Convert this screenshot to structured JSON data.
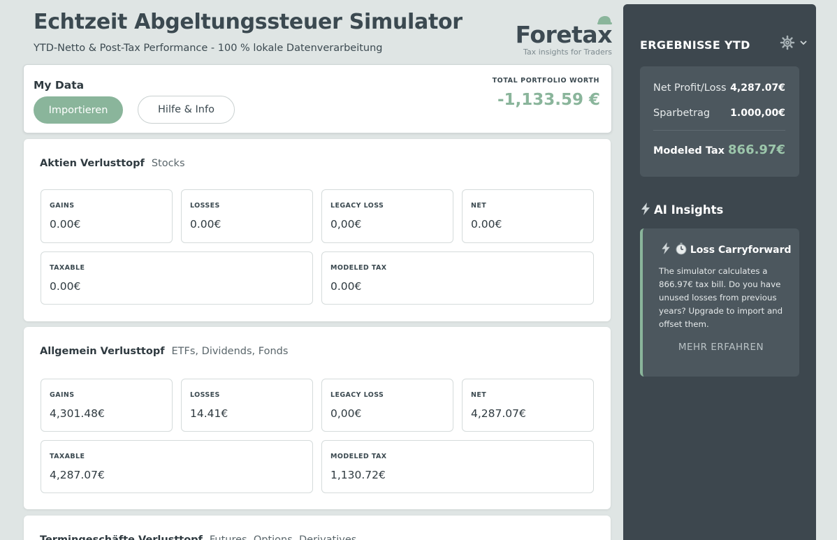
{
  "header": {
    "title": "Echtzeit Abgeltungssteuer Simulator",
    "subtitle": "YTD-Netto & Post-Tax Performance - 100 % lokale Datenverarbeitung",
    "brand_name": "Foretax",
    "brand_tagline": "Tax insights for Traders"
  },
  "my_data": {
    "title": "My Data",
    "import_label": "Importieren",
    "help_label": "Hilfe & Info",
    "worth_label": "TOTAL PORTFOLIO WORTH",
    "worth_value": "-1,133.59 €"
  },
  "pots": [
    {
      "title": "Aktien Verlusttopf",
      "subtitle": "Stocks",
      "gains_label": "GAINS",
      "gains": "0.00€",
      "losses_label": "LOSSES",
      "losses": "0.00€",
      "legacy_label": "LEGACY LOSS",
      "legacy": "0,00€",
      "net_label": "NET",
      "net": "0.00€",
      "taxable_label": "TAXABLE",
      "taxable": "0.00€",
      "tax_label": "MODELED TAX",
      "tax": "0.00€"
    },
    {
      "title": "Allgemein Verlusttopf",
      "subtitle": "ETFs, Dividends, Fonds",
      "gains_label": "GAINS",
      "gains": "4,301.48€",
      "losses_label": "LOSSES",
      "losses": "14.41€",
      "legacy_label": "LEGACY LOSS",
      "legacy": "0,00€",
      "net_label": "NET",
      "net": "4,287.07€",
      "taxable_label": "TAXABLE",
      "taxable": "4,287.07€",
      "tax_label": "MODELED TAX",
      "tax": "1,130.72€"
    },
    {
      "title": "Termingeschäfte Verlusttopf",
      "subtitle": "Futures, Options, Derivatives"
    }
  ],
  "sidebar": {
    "title": "ERGEBNISSE YTD",
    "settings_icon": "gear-icon",
    "results": {
      "net_label": "Net Profit/Loss",
      "net_value": "4,287.07€",
      "saver_label": "Sparbetrag",
      "saver_value": "1.000,00€",
      "tax_label": "Modeled Tax",
      "tax_value": "866.97€"
    },
    "ai": {
      "heading": "AI Insights",
      "card_title": "Loss Carryforward",
      "card_body": "The simulator calculates a 866.97€ tax bill. Do you have unused losses from previous years? Upgrade to import and offset them.",
      "more_label": "MEHR ERFAHREN"
    }
  },
  "colors": {
    "accent": "#8ab59b",
    "sidebar_bg": "#3d474e",
    "page_bg": "#dfe5e4"
  }
}
